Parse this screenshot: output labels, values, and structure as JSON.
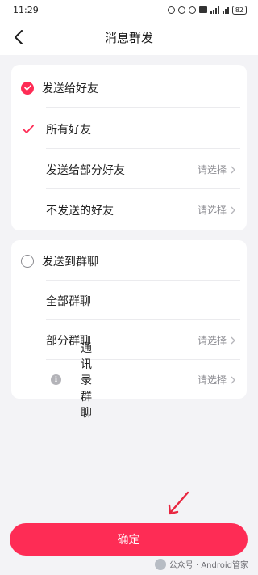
{
  "status_bar": {
    "time": "11:29",
    "battery": "82",
    "icons": [
      "headset-icon",
      "alarm-icon",
      "mute-icon",
      "hd-icon",
      "signal-icon",
      "wifi-icon",
      "battery-icon"
    ]
  },
  "header": {
    "title": "消息群发",
    "back_icon": "chevron-left-icon"
  },
  "friends_group": {
    "label": "发送给好友",
    "selected": true,
    "options": [
      {
        "label": "所有好友",
        "checked": true,
        "hint": ""
      },
      {
        "label": "发送给部分好友",
        "checked": false,
        "hint": "请选择"
      },
      {
        "label": "不发送的好友",
        "checked": false,
        "hint": "请选择"
      }
    ]
  },
  "groups_group": {
    "label": "发送到群聊",
    "selected": false,
    "options": [
      {
        "label": "全部群聊",
        "hint": ""
      },
      {
        "label": "部分群聊",
        "hint": "请选择"
      },
      {
        "label": "通讯录群聊",
        "hint": "请选择",
        "info_icon": "i"
      }
    ]
  },
  "confirm_button": {
    "label": "确定"
  },
  "colors": {
    "accent": "#fe2c55",
    "background": "#f3f3f6",
    "card": "#ffffff",
    "hint": "#8c8c92"
  },
  "watermark": {
    "text": "公众号 · Android管家"
  }
}
